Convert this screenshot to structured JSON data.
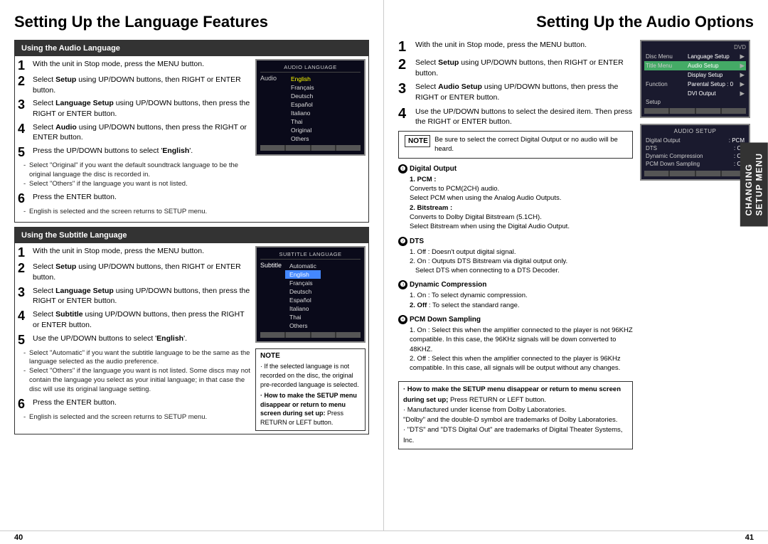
{
  "leftPage": {
    "title": "Setting Up the Language Features",
    "section1": {
      "header": "Using the Audio Language",
      "steps": [
        {
          "num": "1",
          "text": "With the unit in Stop mode, press the MENU button."
        },
        {
          "num": "2",
          "text": "Select Setup using UP/DOWN buttons, then RIGHT or ENTER button."
        },
        {
          "num": "3",
          "text": "Select Language Setup using UP/DOWN buttons, then press the RIGHT or ENTER button."
        },
        {
          "num": "4",
          "text": "Select Audio using UP/DOWN buttons, then press the RIGHT or ENTER button."
        },
        {
          "num": "5",
          "text": "Press the UP/DOWN buttons to select 'English'.",
          "bold_word": "English",
          "subBullets": [
            "Select \"Original\" if you want the default soundtrack language to be the original language the disc is recorded in.",
            "Select \"Others\" if the language you want is not listed."
          ]
        },
        {
          "num": "6",
          "text": "Press the ENTER button.",
          "subBullets": [
            "English is selected and the screen returns to SETUP menu."
          ]
        }
      ],
      "screen": {
        "title": "AUDIO LANGUAGE",
        "label": "Audio",
        "languages": [
          "English",
          "Français",
          "Deutsch",
          "Español",
          "Italiano",
          "Thai",
          "Original",
          "Others"
        ],
        "activeIndex": 0
      }
    },
    "section2": {
      "header": "Using the Subtitle Language",
      "steps": [
        {
          "num": "1",
          "text": "With the unit in Stop mode, press the MENU button."
        },
        {
          "num": "2",
          "text": "Select Setup using UP/DOWN buttons, then RIGHT or ENTER button."
        },
        {
          "num": "3",
          "text": "Select Language Setup using UP/DOWN buttons, then press the RIGHT or ENTER button."
        },
        {
          "num": "4",
          "text": "Select Subtitle using UP/DOWN buttons, then press the RIGHT or ENTER button."
        },
        {
          "num": "5",
          "text": "Use the UP/DOWN buttons to select 'English'.",
          "bold_word": "English",
          "subBullets": [
            "Select \"Automatic\" if you want the subtitle language to be the same as the language selected as the audio preference.",
            "Select \"Others\" if the language you want is not listed. Some discs may not contain the language you select as your initial language; in that case the disc will use its original language setting."
          ]
        },
        {
          "num": "6",
          "text": "Press the ENTER button.",
          "subBullets": [
            "English is selected and the screen returns to SETUP menu."
          ]
        }
      ],
      "screen": {
        "title": "SUBTITLE LANGUAGE",
        "label": "Subtitle",
        "languages": [
          "Automatic",
          "English",
          "Français",
          "Deutsch",
          "Español",
          "Italiano",
          "Thai",
          "Others"
        ],
        "activeIndex": 1
      }
    },
    "note": {
      "title": "NOTE",
      "bullets": [
        "If the selected language is not recorded on the disc, the original pre-recorded language is selected.",
        "How to make the SETUP menu disappear or return to menu screen during set up: Press RETURN or LEFT button."
      ],
      "howToMakeLabel": "· How to make the SETUP menu disappear or return to menu screen during set up:",
      "howToMakeText": "Press RETURN or LEFT button."
    },
    "pageNumber": "40"
  },
  "rightPage": {
    "title": "Setting Up the Audio Options",
    "steps": [
      {
        "num": "1",
        "text": "With the unit in Stop mode, press the MENU button."
      },
      {
        "num": "2",
        "text": "Select Setup using UP/DOWN buttons, then RIGHT or ENTER button."
      },
      {
        "num": "3",
        "text": "Select Audio Setup using UP/DOWN buttons, then press the RIGHT or ENTER button."
      },
      {
        "num": "4",
        "text": "Use the UP/DOWN buttons to select the desired item. Then press the RIGHT or ENTER button."
      }
    ],
    "dvdScreen": {
      "label": "DVD",
      "rows": [
        {
          "label": "Disc Menu",
          "val": "Language Setup",
          "arrow": true,
          "highlighted": false
        },
        {
          "label": "Title Menu",
          "val": "Audio Setup",
          "arrow": true,
          "highlighted": true
        },
        {
          "label": "",
          "val": "Display Setup",
          "arrow": true,
          "highlighted": false
        },
        {
          "label": "Function",
          "val": "Parental Setup : 0",
          "arrow": true,
          "highlighted": false
        },
        {
          "label": "",
          "val": "DVI Output",
          "arrow": true,
          "highlighted": false
        },
        {
          "label": "Setup",
          "val": "",
          "arrow": false,
          "highlighted": false
        }
      ]
    },
    "audioSetupScreen": {
      "title": "AUDIO SETUP",
      "rows": [
        {
          "label": "Digital Output",
          "val": ": PCM"
        },
        {
          "label": "DTS",
          "val": ": Off"
        },
        {
          "label": "Dynamic Compression",
          "val": ": On"
        },
        {
          "label": "PCM Down Sampling",
          "val": ": On"
        }
      ]
    },
    "bullets": [
      {
        "num": "❶",
        "title": "Digital Output",
        "items": [
          {
            "bold": "1. PCM :",
            "text": ""
          },
          {
            "bold": "",
            "text": "Converts to PCM(2CH) audio."
          },
          {
            "bold": "",
            "text": "Select PCM when using the Analog Audio Outputs."
          },
          {
            "bold": "2. Bitstream :",
            "text": ""
          },
          {
            "bold": "",
            "text": "Converts to Dolby Digital Bitstream (5.1CH)."
          },
          {
            "bold": "",
            "text": "Select Bitstream when using the Digital Audio Output."
          }
        ]
      },
      {
        "num": "❷",
        "title": "DTS",
        "items": [
          {
            "bold": "",
            "text": "1. Off : Doesn't output digital signal."
          },
          {
            "bold": "",
            "text": "2. On : Outputs DTS Bitstream via digital output only."
          },
          {
            "bold": "",
            "text": "Select DTS when connecting to a DTS Decoder."
          }
        ]
      },
      {
        "num": "❸",
        "title": "Dynamic Compression",
        "items": [
          {
            "bold": "",
            "text": "1. On : To select dynamic compression."
          },
          {
            "bold": "",
            "text": "2. Off : To select the standard range."
          }
        ]
      },
      {
        "num": "❹",
        "title": "PCM Down Sampling",
        "items": [
          {
            "bold": "",
            "text": "1. On : Select this when the amplifier connected to the player is not 96KHZ compatible. In this case, the 96KHz signals will be down converted to 48KHZ."
          },
          {
            "bold": "",
            "text": "2. Off : Select this when the amplifier connected to the player is 96KHz compatible. In this case, all signals will be output without any changes."
          }
        ]
      }
    ],
    "noteBox": {
      "title": "NOTE",
      "text": "Be sure to select the correct Digital Output or no audio will be heard."
    },
    "bottomNote": {
      "bullets": [
        "· How to make the SETUP menu disappear or return to menu screen during set up; Press RETURN or LEFT button.",
        "· Manufactured under license from Dolby Laboratories.",
        "\"Dolby\" and the double-D symbol are trademarks of Dolby Laboratories.",
        "· \"DTS\" and \"DTS Digital Out\" are trademarks of Digital Theater Systems, Inc."
      ]
    },
    "sidebarTab": {
      "line1": "CHANGING",
      "line2": "SETUP MENU"
    },
    "pageNumber": "41"
  }
}
